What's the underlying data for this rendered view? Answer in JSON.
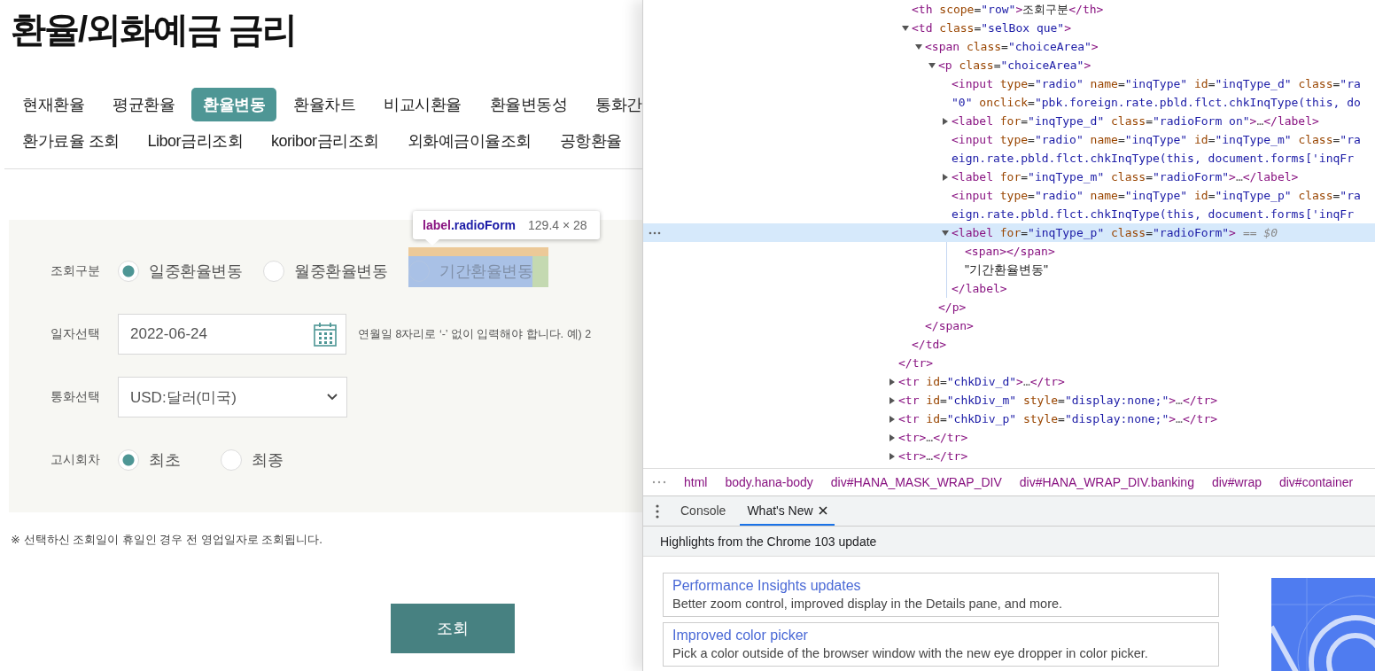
{
  "page": {
    "title": "환율/외화예금 금리",
    "tab_rows": [
      [
        {
          "label": "현재환율",
          "selected": false
        },
        {
          "label": "평균환율",
          "selected": false
        },
        {
          "label": "환율변동",
          "selected": true
        },
        {
          "label": "환율차트",
          "selected": false
        },
        {
          "label": "비교시환율",
          "selected": false
        },
        {
          "label": "환율변동성",
          "selected": false
        },
        {
          "label": "통화간",
          "selected": false
        }
      ],
      [
        {
          "label": "환가료율 조회",
          "selected": false
        },
        {
          "label": "Libor금리조회",
          "selected": false
        },
        {
          "label": "koribor금리조회",
          "selected": false
        },
        {
          "label": "외화예금이율조회",
          "selected": false
        },
        {
          "label": "공항환율",
          "selected": false
        }
      ]
    ],
    "form": [
      {
        "kind": "radio",
        "label": "조회구분",
        "options": [
          {
            "label": "일중환율변동",
            "selected": true,
            "inspected": false
          },
          {
            "label": "월중환율변동",
            "selected": false,
            "inspected": false
          },
          {
            "label": "기간환율변동",
            "selected": false,
            "inspected": true
          }
        ]
      },
      {
        "kind": "date",
        "label": "일자선택",
        "value": "2022-06-24",
        "hint": "연월일 8자리로 ‘-’ 없이 입력해야 합니다. 예) 2"
      },
      {
        "kind": "select",
        "label": "통화선택",
        "value": "USD:달러(미국)"
      },
      {
        "kind": "radio",
        "label": "고시회차",
        "options": [
          {
            "label": "최초",
            "selected": true,
            "inspected": false
          },
          {
            "label": "최종",
            "selected": false,
            "inspected": false
          }
        ]
      }
    ],
    "inspect_tooltip": {
      "selector": "label.radioForm",
      "size": "129.4 × 28"
    },
    "note": "※ 선택하신 조회일이 휴일인 경우 전 영업일자로 조회됩니다.",
    "submit": "조회"
  },
  "devtools": {
    "elements": [
      {
        "kind": "continued",
        "close": "</tr>",
        "children": [
          {
            "kind": "tag",
            "text": "<th scope=\"row\">조회구분</th>",
            "selected": false
          },
          {
            "kind": "element",
            "text": "<td class=\"selBox que\">",
            "expanded": true,
            "selected": false,
            "close": "</td>",
            "children": [
              {
                "kind": "element",
                "text": "<span class=\"choiceArea\">",
                "expanded": true,
                "selected": false,
                "close": "</span>",
                "children": [
                  {
                    "kind": "element",
                    "text": "<p class=\"choiceArea\">",
                    "expanded": true,
                    "selected": false,
                    "close": "</p>",
                    "children": [
                      {
                        "kind": "tag",
                        "text": "<input type=\"radio\" name=\"inqType\" id=\"inqType_d\" class=\"ra",
                        "wrap": "\"0\" onclick=\"pbk.foreign.rate.pbld.flct.chkInqType(this, do",
                        "selected": false
                      },
                      {
                        "kind": "element",
                        "text": "<label for=\"inqType_d\" class=\"radioForm on\">…</label>",
                        "expanded": false,
                        "selected": false
                      },
                      {
                        "kind": "tag",
                        "text": "<input type=\"radio\" name=\"inqType\" id=\"inqType_m\" class=\"ra",
                        "wrap": "eign.rate.pbld.flct.chkInqType(this, document.forms['inqFr",
                        "selected": false
                      },
                      {
                        "kind": "element",
                        "text": "<label for=\"inqType_m\" class=\"radioForm\">…</label>",
                        "expanded": false,
                        "selected": false
                      },
                      {
                        "kind": "tag",
                        "text": "<input type=\"radio\" name=\"inqType\" id=\"inqType_p\" class=\"ra",
                        "wrap": "eign.rate.pbld.flct.chkInqType(this, document.forms['inqFr",
                        "selected": false
                      },
                      {
                        "kind": "element",
                        "text": "<label for=\"inqType_p\" class=\"radioForm\">",
                        "marker": "== $0",
                        "expanded": true,
                        "selected": true,
                        "close": "</label>",
                        "children": [
                          {
                            "kind": "tag",
                            "text": "<span></span>",
                            "selected": false
                          },
                          {
                            "kind": "text",
                            "text": "\"기간환율변동\"",
                            "selected": false
                          }
                        ]
                      }
                    ]
                  }
                ]
              }
            ]
          }
        ]
      },
      {
        "kind": "element",
        "text": "<tr id=\"chkDiv_d\">…</tr>",
        "expanded": false,
        "selected": false
      },
      {
        "kind": "element",
        "text": "<tr id=\"chkDiv_m\" style=\"display:none;\">…</tr>",
        "expanded": false,
        "selected": false
      },
      {
        "kind": "element",
        "text": "<tr id=\"chkDiv_p\" style=\"display:none;\">…</tr>",
        "expanded": false,
        "selected": false
      },
      {
        "kind": "element",
        "text": "<tr>…</tr>",
        "expanded": false,
        "selected": false
      },
      {
        "kind": "element",
        "text": "<tr>…</tr>",
        "expanded": false,
        "selected": false
      }
    ],
    "breadcrumbs": [
      "html",
      "body.hana-body",
      "div#HANA_MASK_WRAP_DIV",
      "div#HANA_WRAP_DIV.banking",
      "div#wrap",
      "div#container"
    ],
    "drawer_tabs": [
      {
        "label": "Console",
        "selected": false,
        "closable": false
      },
      {
        "label": "What's New",
        "selected": true,
        "closable": true
      }
    ],
    "whats_new": {
      "heading": "Highlights from the Chrome 103 update",
      "cards": [
        {
          "title": "Performance Insights updates",
          "description": "Better zoom control, improved display in the Details pane, and more."
        },
        {
          "title": "Improved color picker",
          "description": "Pick a color outside of the browser window with the new eye dropper in color picker."
        }
      ]
    }
  }
}
